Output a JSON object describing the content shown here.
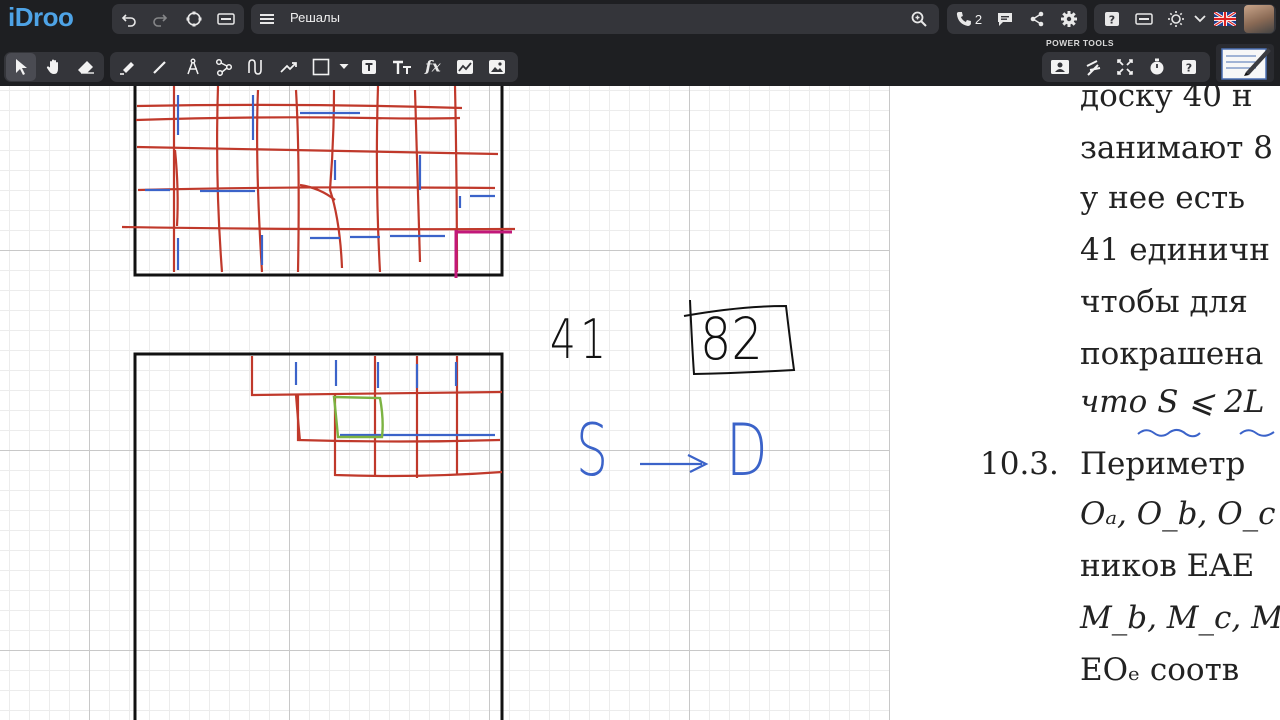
{
  "app": {
    "logo": "iDroo",
    "board_title": "Решалы",
    "power_tools_label": "POWER TOOLS",
    "call_count": "2"
  },
  "toolbar_top": {
    "left_icons": [
      "undo-icon",
      "redo-icon",
      "lasso-icon",
      "keyboard-icon"
    ],
    "menu_icon": "hamburger-menu-icon",
    "search_icon": "zoom-icon",
    "right_icons": [
      "phone-icon",
      "chat-icon",
      "share-icon",
      "settings-gear-icon",
      "help-icon",
      "keyboard-icon",
      "theme-icon",
      "chevron-down-icon",
      "uk-flag-icon",
      "user-avatar"
    ]
  },
  "toolbar_tools": [
    "select-arrow-icon",
    "hand-pan-icon",
    "eraser-icon",
    "highlighter-icon",
    "pen-icon",
    "compass-icon",
    "connector-icon",
    "smooth-curve-icon",
    "arrow-line-icon",
    "rectangle-shape-icon",
    "shape-dropdown-icon",
    "text-box-icon",
    "text-tt-icon",
    "formula-fx-icon",
    "chart-icon",
    "image-icon"
  ],
  "power_tools": [
    "presentation-icon",
    "laser-icon",
    "fullscreen-icon",
    "timer-icon",
    "help-icon",
    "notebook-icon"
  ],
  "canvas": {
    "handwriting": {
      "number_plain": "41",
      "number_boxed": "82",
      "relation_left": "S",
      "relation_right": "D",
      "relation_arrow": "→"
    }
  },
  "document": {
    "lines": [
      "доску 40 н",
      "занимают 8",
      "у нее есть",
      "41 единичн",
      "чтобы для",
      "покрашена",
      "что S ⩽ 2L"
    ],
    "problem_number": "10.3.",
    "problem_lines": [
      "Периметр",
      "Oₐ, O_b, O_c",
      "ников EAE",
      "M_b,  M_c,  M",
      "EOₑ соотв"
    ]
  },
  "colors": {
    "red_grid": "#c0392b",
    "blue_marks": "#3b63c9",
    "green_box": "#7cb342",
    "magenta_mark": "#c2187a",
    "toolbar_bg": "#1e1f22",
    "logo_blue": "#4ea3e6"
  }
}
